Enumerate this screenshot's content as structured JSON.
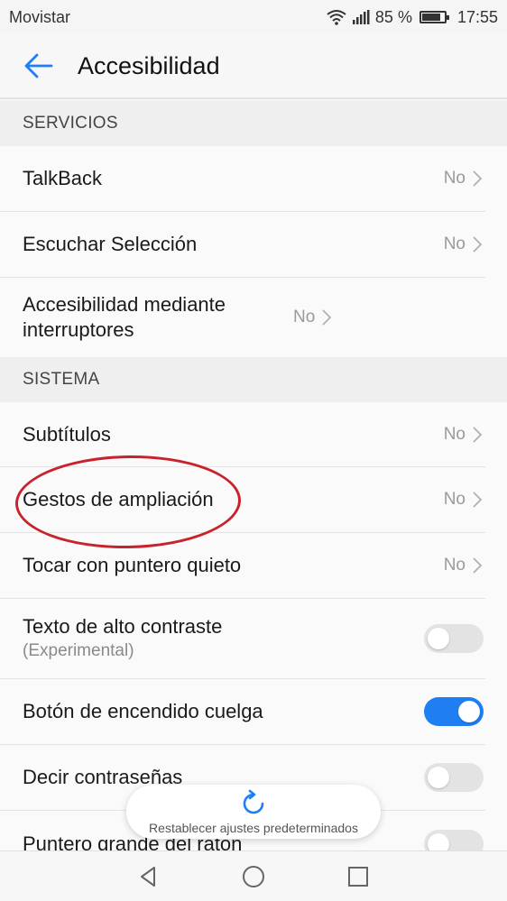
{
  "status": {
    "carrier": "Movistar",
    "battery": "85 %",
    "battery_level": 0.85,
    "time": "17:55"
  },
  "header": {
    "title": "Accesibilidad"
  },
  "sections": {
    "servicios": {
      "title": "SERVICIOS",
      "items": [
        {
          "label": "TalkBack",
          "value": "No"
        },
        {
          "label": "Escuchar Selección",
          "value": "No"
        },
        {
          "label": "Accesibilidad mediante interruptores",
          "value": "No"
        }
      ]
    },
    "sistema": {
      "title": "SISTEMA",
      "items": [
        {
          "label": "Subtítulos",
          "value": "No"
        },
        {
          "label": "Gestos de ampliación",
          "value": "No"
        },
        {
          "label": "Tocar con puntero quieto",
          "value": "No"
        },
        {
          "label": "Texto de alto contraste",
          "sublabel": "(Experimental)",
          "toggle": false
        },
        {
          "label": "Botón de encendido cuelga",
          "toggle": true
        },
        {
          "label": "Decir contraseñas",
          "toggle": false
        },
        {
          "label": "Puntero grande del ratón",
          "toggle": false
        }
      ]
    }
  },
  "reset": {
    "label": "Restablecer ajustes predeterminados"
  },
  "colors": {
    "accent": "#1f7ef2",
    "annotation": "#c8232c"
  }
}
